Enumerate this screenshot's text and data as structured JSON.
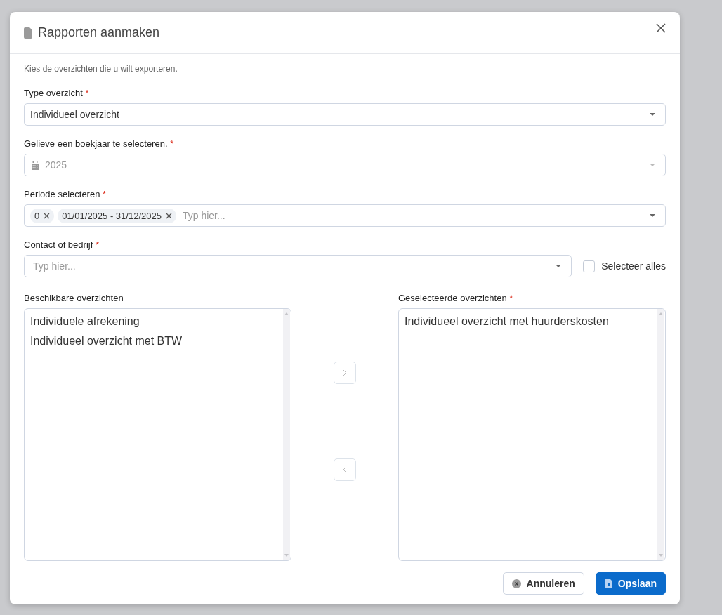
{
  "dialog": {
    "title": "Rapporten aanmaken",
    "intro": "Kies de overzichten die u wilt exporteren.",
    "required_mark": "*",
    "fields": [
      {
        "kind": "select",
        "label": "Type overzicht",
        "required": true,
        "value": "Individueel overzicht",
        "disabled": false
      },
      {
        "kind": "select",
        "label": "Gelieve een boekjaar te selecteren.",
        "required": true,
        "value": "2025",
        "disabled": true
      },
      {
        "kind": "tags",
        "label": "Periode selecteren",
        "required": true,
        "tags": [
          "0",
          "01/01/2025 - 31/12/2025"
        ],
        "placeholder": "Typ hier..."
      },
      {
        "kind": "select-check",
        "label": "Contact of bedrijf",
        "required": true,
        "placeholder": "Typ hier...",
        "checkbox": {
          "label": "Selecteer alles",
          "checked": false
        }
      }
    ],
    "lists": [
      {
        "label": "Beschikbare overzichten",
        "required": false,
        "items": [
          "Individuele afrekening",
          "Individueel overzicht met BTW"
        ]
      },
      {
        "label": "Geselecteerde overzichten",
        "required": true,
        "items": [
          "Individueel overzicht met huurderskosten"
        ]
      }
    ],
    "buttons": [
      {
        "kind": "secondary",
        "label": "Annuleren"
      },
      {
        "kind": "primary",
        "label": "Opslaan"
      }
    ]
  }
}
